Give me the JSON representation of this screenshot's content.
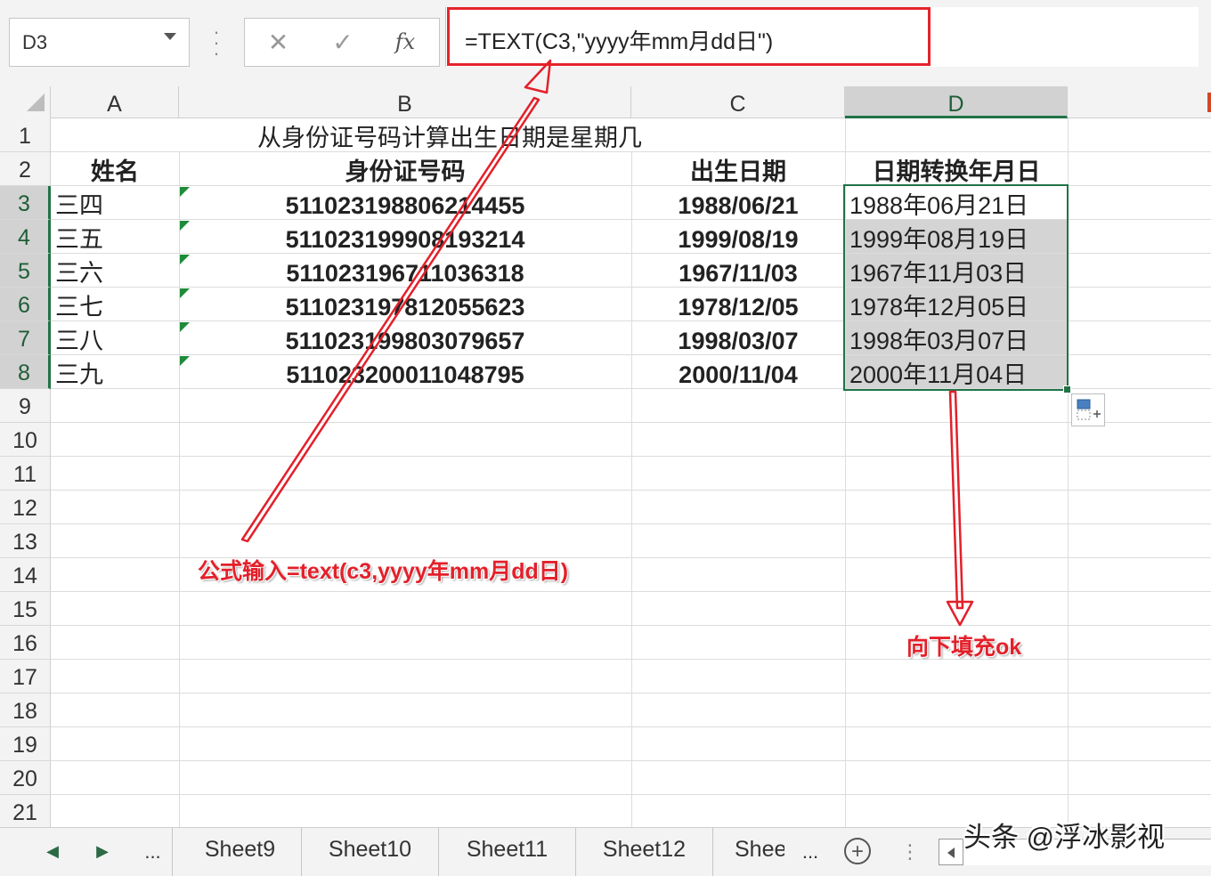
{
  "name_box": {
    "value": "D3"
  },
  "formula_bar": {
    "cancel_glyph": "✕",
    "enter_glyph": "✓",
    "fx_glyph": "fx",
    "formula": "=TEXT(C3,\"yyyy年mm月dd日\")"
  },
  "columns": [
    "A",
    "B",
    "C",
    "D"
  ],
  "rows": [
    "1",
    "2",
    "3",
    "4",
    "5",
    "6",
    "7",
    "8",
    "9",
    "10",
    "11",
    "12",
    "13",
    "14",
    "15",
    "16",
    "17",
    "18",
    "19",
    "20",
    "21"
  ],
  "sheet": {
    "title": "从身份证号码计算出生日期是星期几",
    "headers": {
      "name": "姓名",
      "id": "身份证号码",
      "birth": "出生日期",
      "converted": "日期转换年月日"
    },
    "records": [
      {
        "name": "三四",
        "id": "511023198806214455",
        "birth": "1988/06/21",
        "converted": "1988年06月21日"
      },
      {
        "name": "三五",
        "id": "511023199908193214",
        "birth": "1999/08/19",
        "converted": "1999年08月19日"
      },
      {
        "name": "三六",
        "id": "511023196711036318",
        "birth": "1967/11/03",
        "converted": "1967年11月03日"
      },
      {
        "name": "三七",
        "id": "511023197812055623",
        "birth": "1978/12/05",
        "converted": "1978年12月05日"
      },
      {
        "name": "三八",
        "id": "511023199803079657",
        "birth": "1998/03/07",
        "converted": "1998年03月07日"
      },
      {
        "name": "三九",
        "id": "511023200011048795",
        "birth": "2000/11/04",
        "converted": "2000年11月04日"
      }
    ]
  },
  "annotations": {
    "formula_note": "公式输入=text(c3,yyyy年mm月dd日)",
    "fill_note": "向下填充ok",
    "color": "#e3202a"
  },
  "tabs": {
    "prev": "◀",
    "next": "▶",
    "more": "...",
    "items": [
      "Sheet9",
      "Sheet10",
      "Sheet11",
      "Sheet12",
      "Shee"
    ],
    "overflow": "...",
    "add": "+",
    "divider": "⋮"
  },
  "watermark": "头条 @浮冰影视",
  "colors": {
    "accent_green": "#217346",
    "selection_gray": "#d4d4d4"
  }
}
